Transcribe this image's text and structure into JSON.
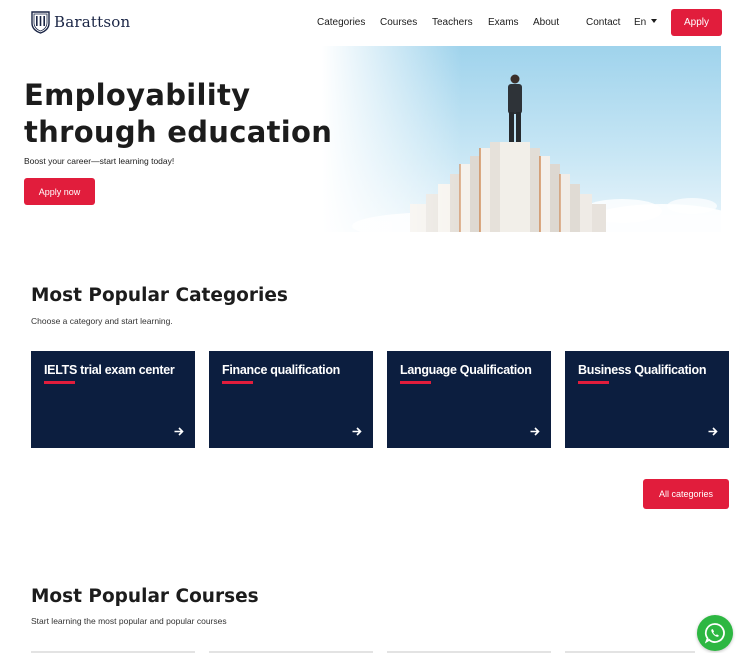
{
  "brand": {
    "name": "Barattson"
  },
  "nav": {
    "links": [
      "Categories",
      "Courses",
      "Teachers",
      "Exams",
      "About",
      "Contact"
    ],
    "language": "En",
    "apply_label": "Apply"
  },
  "hero": {
    "title": "Employability through education",
    "subtitle": "Boost your career—start learning today!",
    "cta_label": "Apply now"
  },
  "categories_section": {
    "title": "Most Popular Categories",
    "subtitle": "Choose a category and start learning.",
    "cards": [
      {
        "label": "IELTS trial exam center"
      },
      {
        "label": "Finance qualification"
      },
      {
        "label": "Language Qualification"
      },
      {
        "label": "Business Qualification"
      }
    ],
    "all_label": "All categories"
  },
  "courses_section": {
    "title": "Most Popular Courses",
    "subtitle": "Start learning the most popular and popular courses"
  },
  "colors": {
    "accent": "#e11d3c",
    "navy": "#0c1e3f",
    "whatsapp": "#2db742"
  },
  "icons": {
    "arrow": "arrow-right-icon",
    "whatsapp": "whatsapp-icon",
    "logo": "shield-crest-icon"
  }
}
